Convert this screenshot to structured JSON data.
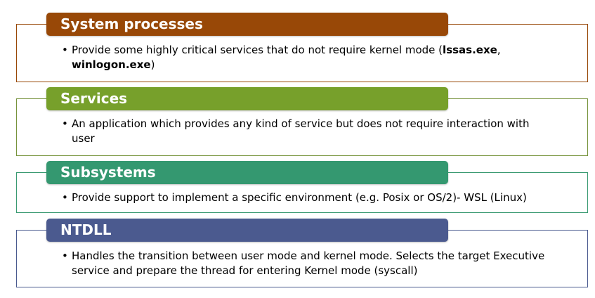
{
  "blocks": [
    {
      "title": "System processes",
      "color": "#984807",
      "bullet": {
        "pre": "Provide some highly critical services that do not require kernel mode (",
        "bold1": "lssas.exe",
        "sep": ", ",
        "bold2": "winlogon.exe",
        "post": ")"
      }
    },
    {
      "title": "Services",
      "color": "#77a02b",
      "bullet": {
        "text": "An application which provides any kind of service but does not require interaction with user"
      }
    },
    {
      "title": "Subsystems",
      "color": "#349870",
      "bullet": {
        "text": "Provide support to implement a specific environment (e.g. Posix or OS/2)-  WSL (Linux)"
      }
    },
    {
      "title": "NTDLL",
      "color": "#4b5a8f",
      "bullet": {
        "text": "Handles the transition between user mode and kernel mode. Selects the target Executive service and prepare the thread for entering Kernel mode (syscall)"
      }
    }
  ],
  "bullet_symbol": "•"
}
